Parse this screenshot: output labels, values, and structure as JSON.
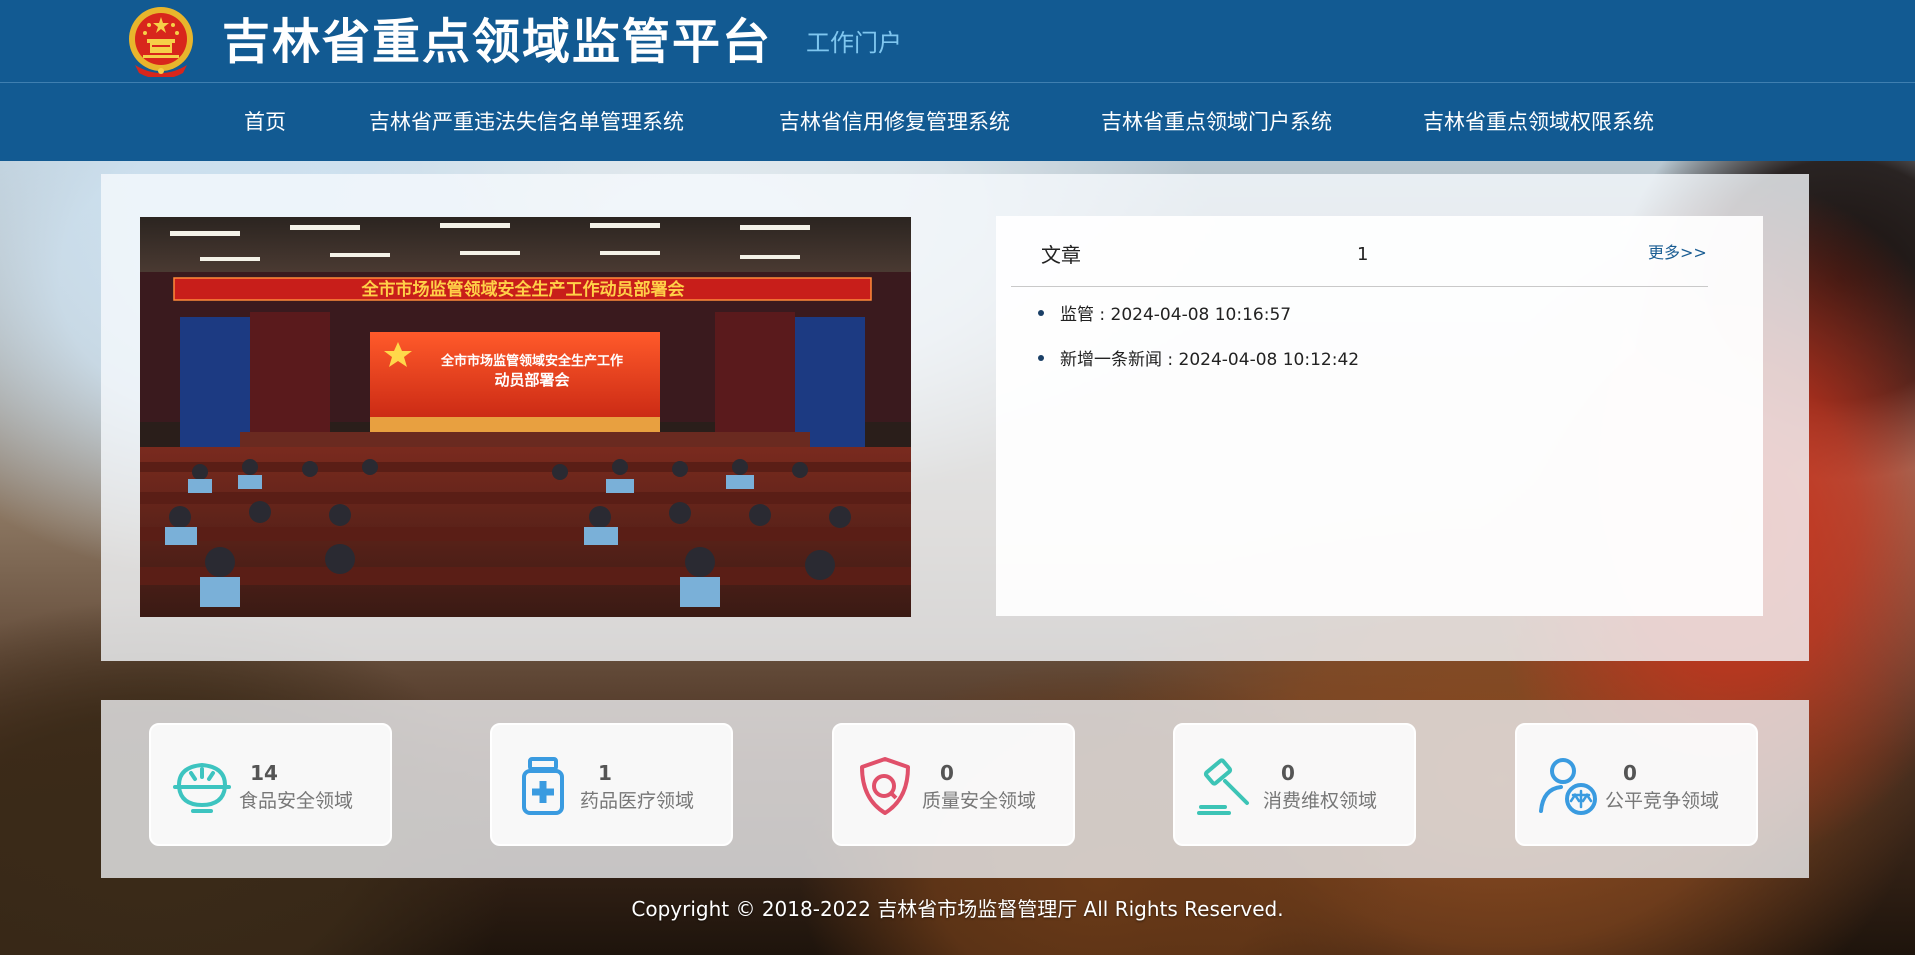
{
  "header": {
    "title": "吉林省重点领域监管平台",
    "subtitle": "工作门户",
    "emblem_icon": "national-emblem-icon"
  },
  "nav": {
    "items": [
      {
        "label": "首页"
      },
      {
        "label": "吉林省严重违法失信名单管理系统"
      },
      {
        "label": "吉林省信用修复管理系统"
      },
      {
        "label": "吉林省重点领域门户系统"
      },
      {
        "label": "吉林省重点领域权限系统"
      }
    ]
  },
  "banner": {
    "banner_text": "全市市场监管领域安全生产工作动员部署会",
    "screen_line1": "全市市场监管领域安全生产工作",
    "screen_line2": "动员部署会"
  },
  "articles": {
    "title": "文章",
    "count": "1",
    "more_label": "更多>>",
    "items": [
      {
        "text": "监管 : 2024-04-08 10:16:57"
      },
      {
        "text": "新增一条新闻 : 2024-04-08 10:12:42"
      }
    ]
  },
  "stats": [
    {
      "count": "14",
      "label": "食品安全领域",
      "icon": "rice-bowl-icon",
      "color": "#3dc4c0"
    },
    {
      "count": "1",
      "label": "药品医疗领域",
      "icon": "medicine-bottle-icon",
      "color": "#3a9be0"
    },
    {
      "count": "0",
      "label": "质量安全领域",
      "icon": "quality-shield-icon",
      "color": "#e0506a"
    },
    {
      "count": "0",
      "label": "消费维权领域",
      "icon": "gavel-icon",
      "color": "#3dc4b6"
    },
    {
      "count": "0",
      "label": "公平竞争领域",
      "icon": "person-scale-icon",
      "color": "#3a9be0"
    }
  ],
  "footer": {
    "copyright": "Copyright © 2018-2022 吉林省市场监督管理厅 All Rights Reserved."
  },
  "colors": {
    "header_bg": "#125a92",
    "subtitle": "#7fc6ef",
    "more_link": "#1a5d93"
  }
}
